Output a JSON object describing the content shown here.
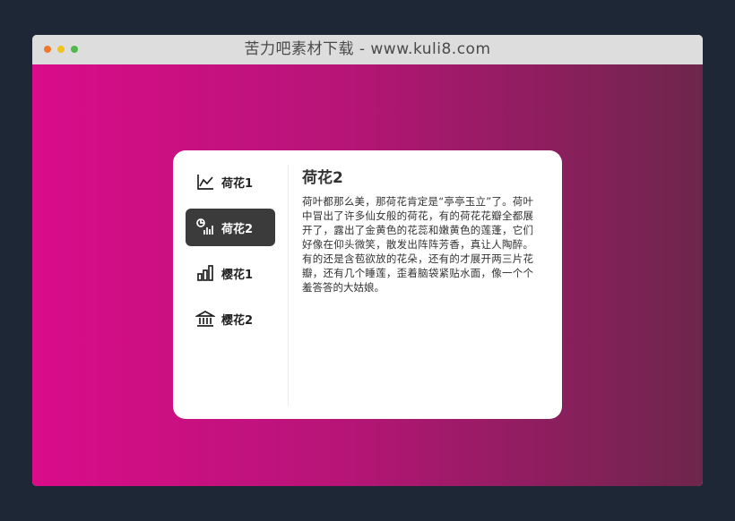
{
  "window": {
    "title": "苦力吧素材下载 - www.kuli8.com"
  },
  "colors": {
    "background": "#1d2735",
    "gradient_start": "#da0c8a",
    "gradient_end": "#6d264b",
    "active_tab": "#3b3b3b"
  },
  "tabs": [
    {
      "label": "荷花1",
      "icon": "area-chart-icon",
      "active": false
    },
    {
      "label": "荷花2",
      "icon": "pie-bar-chart-icon",
      "active": true
    },
    {
      "label": "樱花1",
      "icon": "bar-chart-icon",
      "active": false
    },
    {
      "label": "樱花2",
      "icon": "bank-icon",
      "active": false
    }
  ],
  "content": {
    "title": "荷花2",
    "text": "荷叶都那么美，那荷花肯定是“亭亭玉立”了。荷叶中冒出了许多仙女般的荷花，有的荷花花瓣全都展开了，露出了金黄色的花蕊和嫩黄色的莲蓬，它们好像在仰头微笑，散发出阵阵芳香，真让人陶醉。有的还是含苞欲放的花朵，还有的才展开两三片花瓣，还有几个睡莲，歪着脑袋紧贴水面，像一个个羞答答的大姑娘。"
  }
}
